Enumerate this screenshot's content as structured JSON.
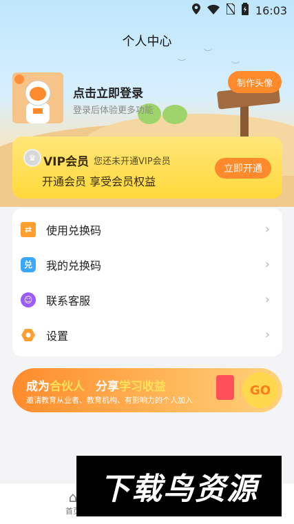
{
  "status_bar": {
    "time": "16:03"
  },
  "header": {
    "title": "个人中心"
  },
  "profile": {
    "login_title": "点击立即登录",
    "login_subtitle": "登录后体验更多功能",
    "make_avatar_button": "制作头像"
  },
  "vip": {
    "title": "VIP会员",
    "note": "您还未开通VIP会员",
    "description": "开通会员 享受会员权益",
    "button": "立即开通"
  },
  "menu": {
    "items": [
      {
        "label": "使用兑换码",
        "icon": "ticket-icon",
        "color": "#ff9f2f"
      },
      {
        "label": "我的兑换码",
        "icon": "redeem-code-icon",
        "color": "#3aa8ff"
      },
      {
        "label": "联系客服",
        "icon": "customer-service-icon",
        "color": "#9b5cff"
      },
      {
        "label": "设置",
        "icon": "gear-icon",
        "color": "#ff9f2f"
      }
    ]
  },
  "partner_banner": {
    "prefix": "成为",
    "highlight1": "合伙人",
    "middle": "分享",
    "highlight2": "学习收益",
    "subtitle": "邀请教育从业者、教育机构、有影响力的个人加入",
    "go_label": "GO"
  },
  "bottom_nav": {
    "home_label": "首页"
  },
  "watermark": {
    "text": "下载鸟资源"
  },
  "colors": {
    "accent": "#ff8a2b",
    "vip_yellow": "#ffd93a"
  }
}
